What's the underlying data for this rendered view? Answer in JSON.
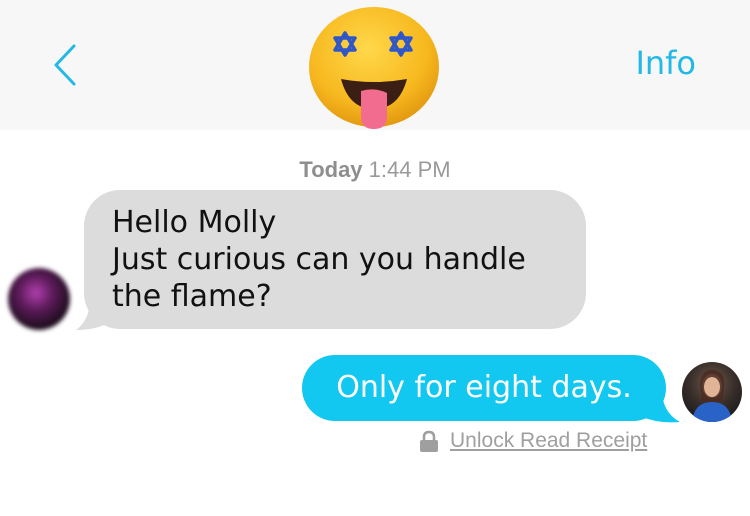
{
  "header": {
    "back_icon": "chevron-left-icon",
    "info_label": "Info",
    "contact_emoji": "star-of-david-eyes-tongue-emoji"
  },
  "timestamp": {
    "day": "Today",
    "time": "1:44 PM"
  },
  "messages": [
    {
      "direction": "incoming",
      "lines": [
        "Hello Molly",
        "Just curious can you handle",
        "the flame?"
      ]
    },
    {
      "direction": "outgoing",
      "text": "Only for eight days."
    }
  ],
  "receipt": {
    "icon": "lock-icon",
    "label": "Unlock Read Receipt"
  },
  "colors": {
    "accent": "#23b9e6",
    "outgoing_bubble": "#12c8f0",
    "incoming_bubble": "#dcdcdc",
    "header_bg": "#f7f7f7",
    "muted_text": "#9a9a9a"
  }
}
